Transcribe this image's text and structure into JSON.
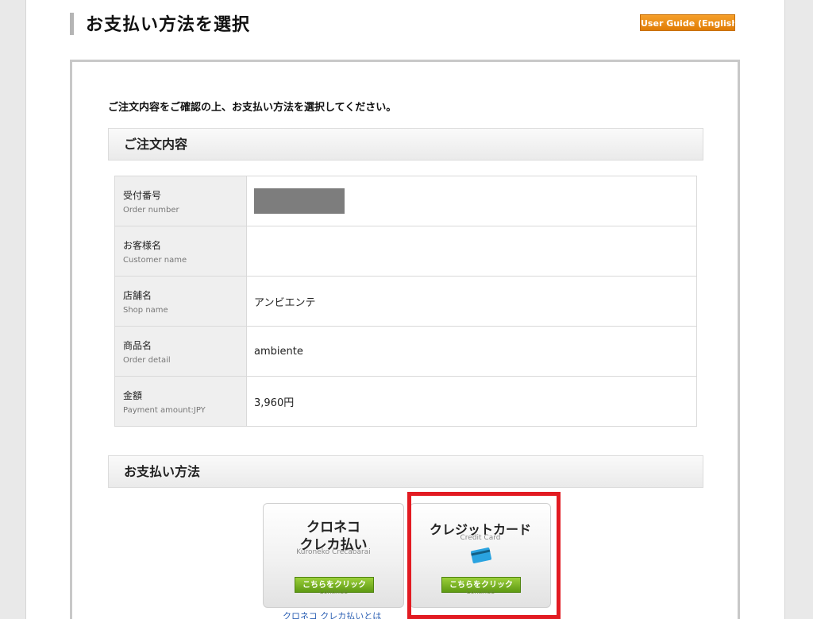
{
  "header": {
    "title": "お支払い方法を選択",
    "guide_label": "User Guide (English)"
  },
  "intro_text": "ご注文内容をご確認の上、お支払い方法を選択してください。",
  "order_section": {
    "heading": "ご注文内容",
    "rows": [
      {
        "label_jp": "受付番号",
        "label_en": "Order number",
        "value": ""
      },
      {
        "label_jp": "お客様名",
        "label_en": "Customer name",
        "value": ""
      },
      {
        "label_jp": "店舗名",
        "label_en": "Shop name",
        "value": "アンビエンテ"
      },
      {
        "label_jp": "商品名",
        "label_en": "Order detail",
        "value": "ambiente"
      },
      {
        "label_jp": "金額",
        "label_en": "Payment amount:JPY",
        "value": "3,960円"
      }
    ]
  },
  "payment_section": {
    "heading": "お支払い方法",
    "options": [
      {
        "name_line1": "クロネコ",
        "name_line2": "クレカ払い",
        "subtitle": "Kuroneko Crecabarai",
        "button_label": "こちらをクリック",
        "button_sub": "Continue",
        "info_link": "クロネコ クレカ払いとは"
      },
      {
        "name": "クレジットカード",
        "subtitle": "Credit Card",
        "icon": "credit-card-icon",
        "button_label": "こちらをクリック",
        "button_sub": "Continue"
      }
    ]
  },
  "colors": {
    "guide_button": "#e98a14",
    "highlight": "#e21b22",
    "continue_button": "#6aa81c",
    "card_icon": "#2aa3e0"
  }
}
